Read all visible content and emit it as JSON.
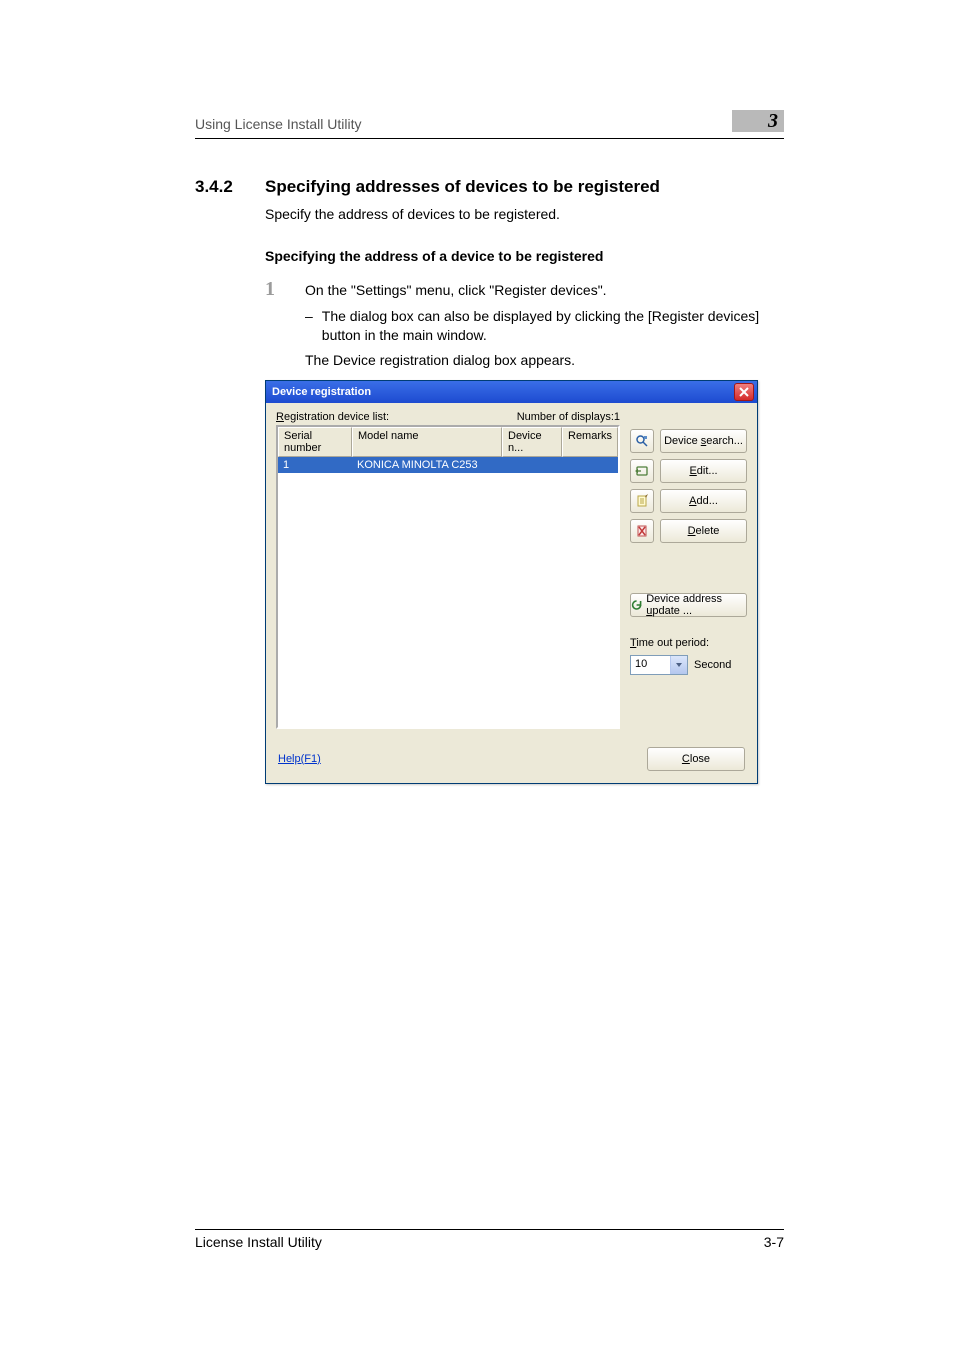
{
  "header": {
    "breadcrumb": "Using License Install Utility",
    "chapter": "3"
  },
  "section": {
    "number": "3.4.2",
    "title": "Specifying addresses of devices to be registered",
    "intro": "Specify the address of devices to be registered.",
    "subheading": "Specifying the address of a device to be registered"
  },
  "step1": {
    "number": "1",
    "text": "On the \"Settings\" menu, click \"Register devices\".",
    "bullet": "The dialog box can also be displayed by clicking the [Register devices] button in the main window.",
    "result": "The Device registration dialog box appears."
  },
  "dialog": {
    "title": "Device registration",
    "list_label_prefix": "R",
    "list_label_rest": "egistration device list:",
    "displays": "Number of displays:1",
    "columns": {
      "serial": "Serial number",
      "model": "Model name",
      "devname": "Device n...",
      "remarks": "Remarks"
    },
    "row": {
      "serial": "1",
      "model": "KONICA MINOLTA C253"
    },
    "buttons": {
      "search_prefix": "Device ",
      "search_u": "s",
      "search_rest": "earch...",
      "edit_u": "E",
      "edit_rest": "dit...",
      "add_u": "A",
      "add_rest": "dd...",
      "delete_u": "D",
      "delete_rest": "elete",
      "update_prefix": "Device address ",
      "update_u": "u",
      "update_rest": "pdate ...",
      "timeout_u": "T",
      "timeout_rest": "ime out period:",
      "timeout_value": "10",
      "timeout_unit": "Second",
      "close_u": "C",
      "close_rest": "lose",
      "help": "Help(F1)"
    }
  },
  "footer": {
    "product": "License Install Utility",
    "page": "3-7"
  }
}
